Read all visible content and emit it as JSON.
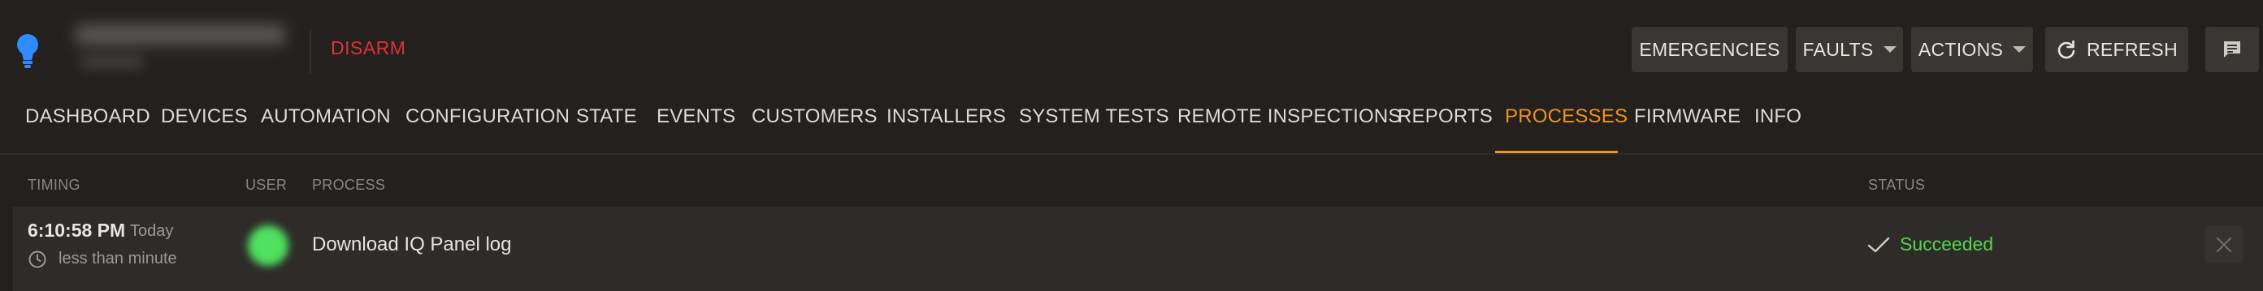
{
  "header": {
    "disarm_label": "DISARM",
    "buttons": {
      "emergencies": "EMERGENCIES",
      "faults": "FAULTS",
      "actions": "ACTIONS",
      "refresh": "REFRESH"
    }
  },
  "nav": {
    "items": [
      "DASHBOARD",
      "DEVICES",
      "AUTOMATION",
      "CONFIGURATION",
      "STATE",
      "EVENTS",
      "CUSTOMERS",
      "INSTALLERS",
      "SYSTEM TESTS",
      "REMOTE INSPECTIONS",
      "REPORTS",
      "PROCESSES",
      "FIRMWARE",
      "INFO"
    ],
    "active": "PROCESSES"
  },
  "table": {
    "headers": {
      "timing": "TIMING",
      "user": "USER",
      "process": "PROCESS",
      "status": "STATUS"
    },
    "rows": [
      {
        "time": "6:10:58 PM",
        "day": "Today",
        "duration": "less than minute",
        "process": "Download IQ Panel log",
        "status": "Succeeded"
      }
    ]
  },
  "colors": {
    "accent": "#f0921f",
    "disarm": "#e0313e",
    "success": "#52d54c",
    "bulb": "#2f8cff"
  },
  "icons": [
    "lightbulb-icon",
    "chevron-down-icon",
    "refresh-icon",
    "chat-icon",
    "clock-icon",
    "checkmark-icon",
    "close-icon"
  ]
}
